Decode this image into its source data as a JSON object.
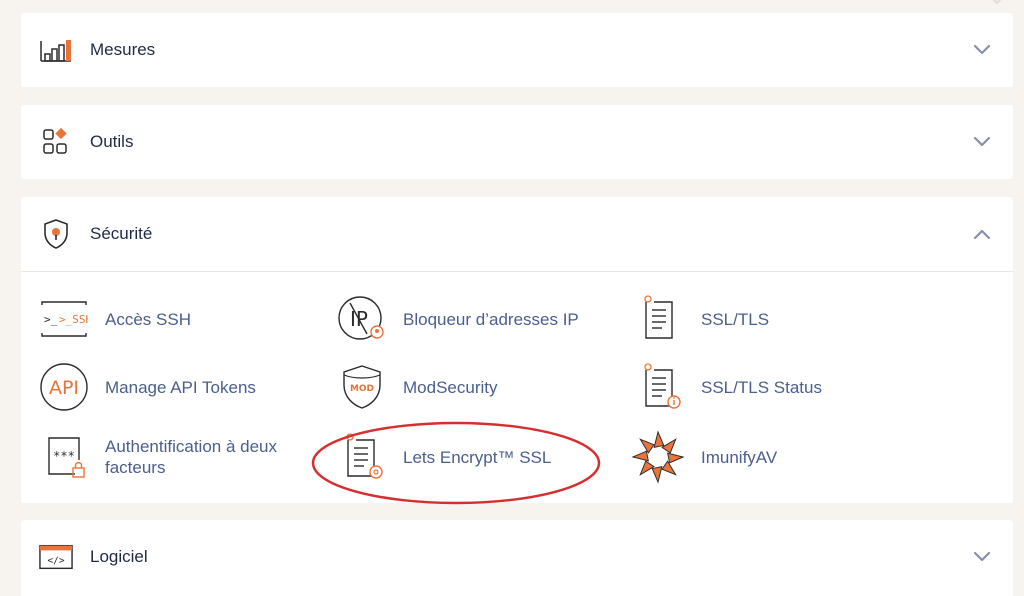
{
  "colors": {
    "accent": "#e8743b",
    "icon_dark": "#2b2b2b",
    "label": "#4a5f8e",
    "title": "#1f2a44",
    "chevron": "#8592a8",
    "annotation": "#d62f2f"
  },
  "panels": {
    "mesures": {
      "title": "Mesures",
      "icon": "bar-chart-icon",
      "expanded": false
    },
    "outils": {
      "title": "Outils",
      "icon": "tools-grid-icon",
      "expanded": false
    },
    "securite": {
      "title": "Sécurité",
      "icon": "shield-icon",
      "expanded": true,
      "items": {
        "ssh": {
          "label": "Accès SSH",
          "icon_text": ">_SSH"
        },
        "api": {
          "label": "Manage API Tokens",
          "icon_text": "API"
        },
        "twofa": {
          "label": "Authentification à deux facteurs",
          "icon_text": "***"
        },
        "ip": {
          "label": "Bloqueur d’adresses IP",
          "icon_text": "IP"
        },
        "modsec": {
          "label": "ModSecurity",
          "icon_text": "MOD"
        },
        "letsencrypt": {
          "label": "Lets Encrypt™ SSL"
        },
        "ssltls": {
          "label": "SSL/TLS"
        },
        "ssltls_status": {
          "label": "SSL/TLS Status"
        },
        "imunify": {
          "label": "ImunifyAV"
        }
      }
    },
    "logiciel": {
      "title": "Logiciel",
      "icon": "code-window-icon",
      "expanded": false
    }
  }
}
